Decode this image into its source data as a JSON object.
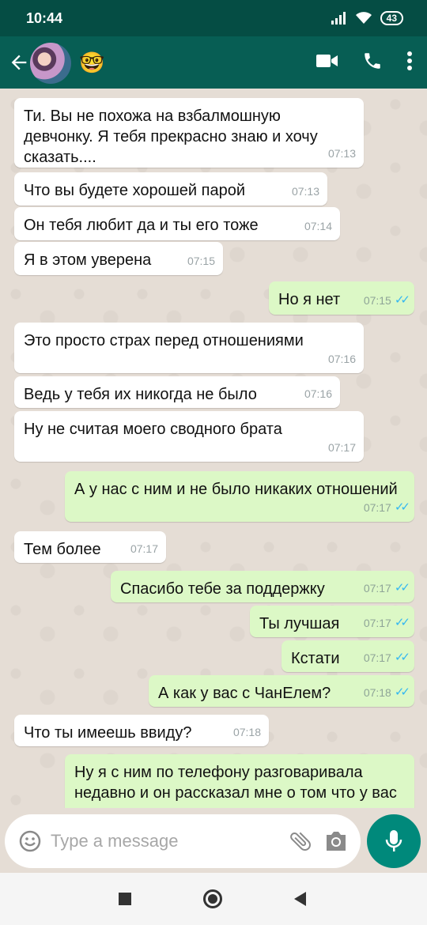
{
  "status_bar": {
    "time": "10:44",
    "battery": "43"
  },
  "contact": {
    "emoji": "🤓"
  },
  "composer": {
    "placeholder": "Type a message"
  },
  "messages": [
    {
      "dir": "in",
      "text": "Ти. Вы не похожа на взбалмошную девчонку. Я тебя прекрасно знаю и хочу сказать....",
      "time": "07:13"
    },
    {
      "dir": "in",
      "text": "Что вы будете хорошей парой",
      "time": "07:13"
    },
    {
      "dir": "in",
      "text": "Он тебя любит да и ты его тоже",
      "time": "07:14"
    },
    {
      "dir": "in",
      "text": "Я в этом уверена",
      "time": "07:15"
    },
    {
      "dir": "out",
      "text": "Но я нет",
      "time": "07:15",
      "ticks": "✓✓"
    },
    {
      "dir": "in",
      "text": "Это просто страх перед отношениями",
      "time": "07:16"
    },
    {
      "dir": "in",
      "text": "Ведь у тебя их никогда не было",
      "time": "07:16"
    },
    {
      "dir": "in",
      "text": "Ну не считая моего сводного брата",
      "time": "07:17"
    },
    {
      "dir": "out",
      "text": "А у нас с ним и не было никаких отношений",
      "time": "07:17",
      "ticks": "✓✓"
    },
    {
      "dir": "in",
      "text": "Тем более",
      "time": "07:17"
    },
    {
      "dir": "out",
      "text": "Спасибо тебе за поддержку",
      "time": "07:17",
      "ticks": "✓✓"
    },
    {
      "dir": "out",
      "text": "Ты лучшая",
      "time": "07:17",
      "ticks": "✓✓"
    },
    {
      "dir": "out",
      "text": "Кстати",
      "time": "07:17",
      "ticks": "✓✓"
    },
    {
      "dir": "out",
      "text": "А как у вас с ЧанЕлем?",
      "time": "07:18",
      "ticks": "✓✓"
    },
    {
      "dir": "in",
      "text": "Что ты имеешь ввиду?",
      "time": "07:18"
    },
    {
      "dir": "out",
      "text": "Ну я с ним по телефону разговаривала недавно и он рассказал мне о том что у вас отношения",
      "time": ""
    }
  ]
}
